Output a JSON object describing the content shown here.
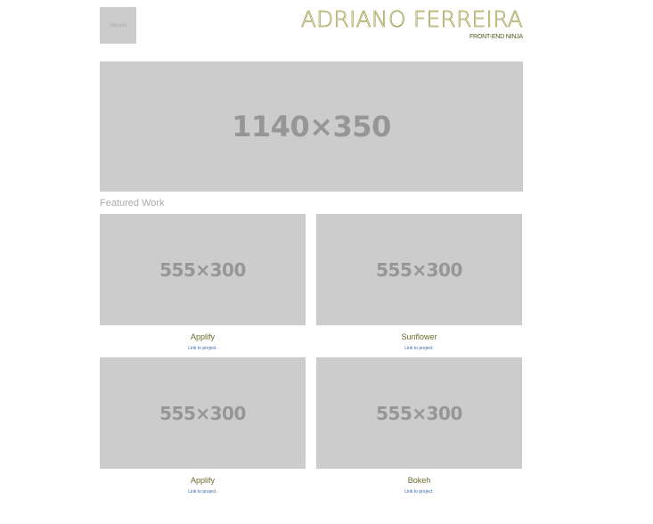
{
  "header": {
    "logo_text": "150×150",
    "name": "ADRIANO FERREIRA",
    "tagline": "FRONT-END NINJA"
  },
  "hero": {
    "label": "1140×350"
  },
  "featured": {
    "section_title": "Featured Work",
    "items": [
      {
        "image_label": "555×300",
        "title": "Applify",
        "link": "Link to project."
      },
      {
        "image_label": "555×300",
        "title": "Sunflower",
        "link": "Link to project."
      },
      {
        "image_label": "555×300",
        "title": "Applify",
        "link": "Link to project."
      },
      {
        "image_label": "555×300",
        "title": "Bokeh",
        "link": "Link to project."
      }
    ]
  }
}
